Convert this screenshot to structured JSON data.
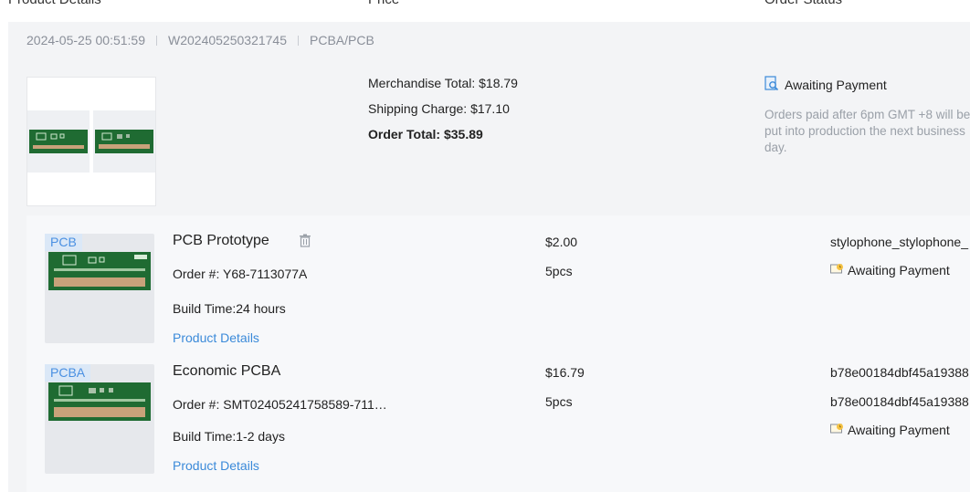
{
  "columns": {
    "product": "Product Details",
    "price": "Price",
    "status": "Order Status"
  },
  "order": {
    "datetime": "2024-05-25 00:51:59",
    "order_id": "W202405250321745",
    "type": "PCBA/PCB",
    "merchandise_total": "Merchandise Total: $18.79",
    "shipping_charge": "Shipping Charge: $17.10",
    "order_total": "Order Total: $35.89",
    "status": "Awaiting Payment",
    "status_note": "Orders paid after 6pm GMT +8 will be put into production the next business day."
  },
  "items": [
    {
      "tag": "PCB",
      "title": "PCB Prototype",
      "order_no": "Order #: Y68-7113077A",
      "build_time": "Build Time:24 hours",
      "details_link": "Product Details",
      "price": "$2.00",
      "qty": "5pcs",
      "file_name": "stylophone_stylophone_",
      "status": "Awaiting Payment"
    },
    {
      "tag": "PCBA",
      "title": "Economic PCBA",
      "order_no": "Order #: SMT02405241758589-711…",
      "build_time": "Build Time:1-2 days",
      "details_link": "Product Details",
      "price": "$16.79",
      "qty": "5pcs",
      "file_name": "b78e00184dbf45a19388",
      "file_name2": "b78e00184dbf45a19388",
      "status": "Awaiting Payment"
    }
  ],
  "colors": {
    "accent": "#3b8ad9",
    "tag_bg": "#dbe8f7",
    "board_green": "#1f6b32",
    "muted": "#8a8f99"
  },
  "icons": {
    "order_status": "document-search-icon",
    "item_status": "payment-pending-icon",
    "delete": "trash-icon"
  }
}
